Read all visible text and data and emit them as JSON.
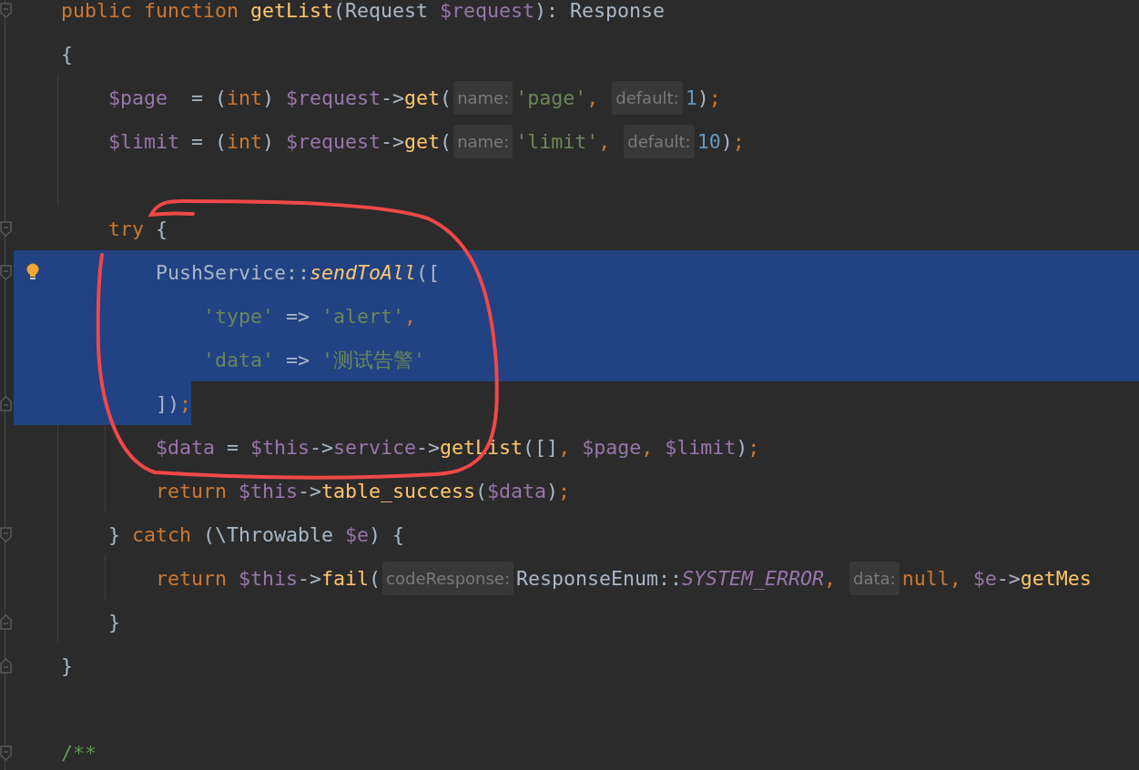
{
  "editor": {
    "lines": [
      {
        "fold_start": true,
        "fold_end": false,
        "bulb": false,
        "selected": false,
        "tokens": [
          {
            "kind": "kw",
            "text": "public function "
          },
          {
            "kind": "fn",
            "text": "getList"
          },
          {
            "kind": "plain",
            "text": "(Request "
          },
          {
            "kind": "var",
            "text": "$request"
          },
          {
            "kind": "plain",
            "text": "): Response"
          }
        ]
      },
      {
        "fold_start": false,
        "fold_end": false,
        "bulb": false,
        "selected": false,
        "tokens": [
          {
            "kind": "plain",
            "text": "{"
          }
        ]
      },
      {
        "fold_start": false,
        "fold_end": false,
        "bulb": false,
        "selected": false,
        "tokens": [
          {
            "kind": "var",
            "text": "    $page"
          },
          {
            "kind": "plain",
            "text": "  = ("
          },
          {
            "kind": "kw",
            "text": "int"
          },
          {
            "kind": "plain",
            "text": ") "
          },
          {
            "kind": "var",
            "text": "$request"
          },
          {
            "kind": "plain",
            "text": "->"
          },
          {
            "kind": "fn",
            "text": "get"
          },
          {
            "kind": "plain",
            "text": "("
          },
          {
            "kind": "hint",
            "text": "name:"
          },
          {
            "kind": "str",
            "text": "'page'"
          },
          {
            "kind": "kw",
            "text": ", "
          },
          {
            "kind": "hint",
            "text": "default:"
          },
          {
            "kind": "num",
            "text": "1"
          },
          {
            "kind": "plain",
            "text": ")"
          },
          {
            "kind": "kw",
            "text": ";"
          }
        ]
      },
      {
        "fold_start": false,
        "fold_end": false,
        "bulb": false,
        "selected": false,
        "tokens": [
          {
            "kind": "var",
            "text": "    $limit"
          },
          {
            "kind": "plain",
            "text": " = ("
          },
          {
            "kind": "kw",
            "text": "int"
          },
          {
            "kind": "plain",
            "text": ") "
          },
          {
            "kind": "var",
            "text": "$request"
          },
          {
            "kind": "plain",
            "text": "->"
          },
          {
            "kind": "fn",
            "text": "get"
          },
          {
            "kind": "plain",
            "text": "("
          },
          {
            "kind": "hint",
            "text": "name:"
          },
          {
            "kind": "str",
            "text": "'limit'"
          },
          {
            "kind": "kw",
            "text": ", "
          },
          {
            "kind": "hint",
            "text": "default:"
          },
          {
            "kind": "num",
            "text": "10"
          },
          {
            "kind": "plain",
            "text": ")"
          },
          {
            "kind": "kw",
            "text": ";"
          }
        ]
      },
      {
        "fold_start": false,
        "fold_end": false,
        "bulb": false,
        "selected": false
      },
      {
        "fold_start": true,
        "fold_end": false,
        "bulb": false,
        "selected": false,
        "tokens": [
          {
            "kind": "kw",
            "text": "    try"
          },
          {
            "kind": "plain",
            "text": " {"
          }
        ]
      },
      {
        "fold_start": true,
        "fold_end": false,
        "bulb": true,
        "selected": true,
        "full_width": true,
        "tokens": [
          {
            "kind": "plain",
            "text": "        PushService::"
          },
          {
            "kind": "fn-italic",
            "text": "sendToAll"
          },
          {
            "kind": "plain",
            "text": "(["
          }
        ]
      },
      {
        "fold_start": false,
        "fold_end": false,
        "bulb": false,
        "selected": true,
        "full_width": true,
        "tokens": [
          {
            "kind": "str",
            "text": "            'type'"
          },
          {
            "kind": "plain",
            "text": " => "
          },
          {
            "kind": "str",
            "text": "'alert'"
          },
          {
            "kind": "kw",
            "text": ","
          }
        ]
      },
      {
        "fold_start": false,
        "fold_end": false,
        "bulb": false,
        "selected": true,
        "full_width": true,
        "tokens": [
          {
            "kind": "str",
            "text": "            'data'"
          },
          {
            "kind": "plain",
            "text": " => "
          },
          {
            "kind": "str",
            "text": "'测试告警'"
          }
        ]
      },
      {
        "fold_start": false,
        "fold_end": true,
        "bulb": false,
        "selected": true,
        "full_width": false,
        "tokens": [
          {
            "kind": "plain",
            "text": "        ])"
          },
          {
            "kind": "kw",
            "text": ";"
          }
        ]
      },
      {
        "fold_start": false,
        "fold_end": false,
        "bulb": false,
        "selected": false,
        "tokens": [
          {
            "kind": "var",
            "text": "        $data"
          },
          {
            "kind": "plain",
            "text": " = "
          },
          {
            "kind": "var",
            "text": "$this"
          },
          {
            "kind": "plain",
            "text": "->"
          },
          {
            "kind": "var",
            "text": "service"
          },
          {
            "kind": "plain",
            "text": "->"
          },
          {
            "kind": "fn",
            "text": "getList"
          },
          {
            "kind": "plain",
            "text": "([]"
          },
          {
            "kind": "kw",
            "text": ", "
          },
          {
            "kind": "var",
            "text": "$page"
          },
          {
            "kind": "kw",
            "text": ", "
          },
          {
            "kind": "var",
            "text": "$limit"
          },
          {
            "kind": "plain",
            "text": ")"
          },
          {
            "kind": "kw",
            "text": ";"
          }
        ]
      },
      {
        "fold_start": false,
        "fold_end": false,
        "bulb": false,
        "selected": false,
        "tokens": [
          {
            "kind": "kw",
            "text": "        return "
          },
          {
            "kind": "var",
            "text": "$this"
          },
          {
            "kind": "plain",
            "text": "->"
          },
          {
            "kind": "fn",
            "text": "table_success"
          },
          {
            "kind": "plain",
            "text": "("
          },
          {
            "kind": "var",
            "text": "$data"
          },
          {
            "kind": "plain",
            "text": ")"
          },
          {
            "kind": "kw",
            "text": ";"
          }
        ]
      },
      {
        "fold_start": true,
        "fold_end": false,
        "bulb": false,
        "selected": false,
        "tokens": [
          {
            "kind": "plain",
            "text": "    } "
          },
          {
            "kind": "kw",
            "text": "catch"
          },
          {
            "kind": "plain",
            "text": " (\\Throwable "
          },
          {
            "kind": "var",
            "text": "$e"
          },
          {
            "kind": "plain",
            "text": ") {"
          }
        ]
      },
      {
        "fold_start": false,
        "fold_end": false,
        "bulb": false,
        "selected": false,
        "tokens": [
          {
            "kind": "kw",
            "text": "        return "
          },
          {
            "kind": "var",
            "text": "$this"
          },
          {
            "kind": "plain",
            "text": "->"
          },
          {
            "kind": "fn",
            "text": "fail"
          },
          {
            "kind": "plain",
            "text": "("
          },
          {
            "kind": "hint",
            "text": "codeResponse:"
          },
          {
            "kind": "plain",
            "text": "ResponseEnum::"
          },
          {
            "kind": "static",
            "text": "SYSTEM_ERROR"
          },
          {
            "kind": "kw",
            "text": ", "
          },
          {
            "kind": "hint",
            "text": "data:"
          },
          {
            "kind": "kw",
            "text": "null, "
          },
          {
            "kind": "var",
            "text": "$e"
          },
          {
            "kind": "plain",
            "text": "->"
          },
          {
            "kind": "fn",
            "text": "getMes"
          }
        ]
      },
      {
        "fold_start": false,
        "fold_end": true,
        "bulb": false,
        "selected": false,
        "tokens": [
          {
            "kind": "plain",
            "text": "    }"
          }
        ]
      },
      {
        "fold_start": false,
        "fold_end": true,
        "bulb": false,
        "selected": false,
        "tokens": [
          {
            "kind": "plain",
            "text": "}"
          }
        ]
      },
      {
        "fold_start": false,
        "fold_end": false,
        "bulb": false,
        "selected": false
      },
      {
        "fold_start": true,
        "fold_end": false,
        "bulb": false,
        "selected": false,
        "tokens": [
          {
            "kind": "comment",
            "text": "/**"
          }
        ]
      }
    ]
  }
}
